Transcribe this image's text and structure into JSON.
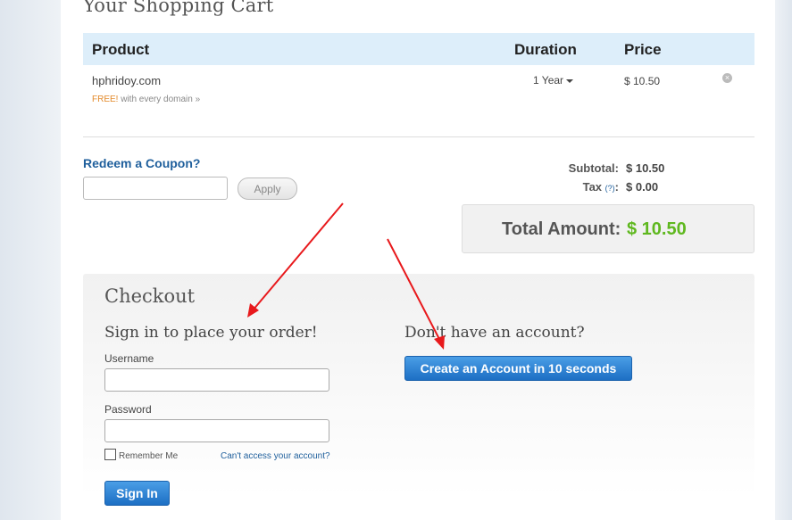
{
  "cart": {
    "title": "Your Shopping Cart",
    "columns": {
      "product": "Product",
      "duration": "Duration",
      "price": "Price"
    },
    "item": {
      "name": "hphridoy.com",
      "free_word": "FREE!",
      "free_rest": " with every domain »",
      "duration": "1 Year",
      "price": "$ 10.50"
    }
  },
  "coupon": {
    "label": "Redeem a Coupon?",
    "input_value": "",
    "apply_label": "Apply"
  },
  "totals": {
    "subtotal_label": "Subtotal:",
    "subtotal_value": "$ 10.50",
    "tax_label": "Tax",
    "tax_help": "(?)",
    "tax_colon": ":",
    "tax_value": "$ 0.00",
    "total_label": "Total Amount:",
    "total_value": "$ 10.50",
    "total_color": "#5fb81f"
  },
  "checkout": {
    "title": "Checkout",
    "signin_title": "Sign in to place your order!",
    "username_label": "Username",
    "username_value": "",
    "password_label": "Password",
    "password_value": "",
    "remember_label": "Remember Me",
    "remember_checked": false,
    "forgot_link": "Can't access your account?",
    "signin_button": "Sign In",
    "noaccount_title": "Don't have an account?",
    "create_button": "Create an Account in 10 seconds"
  },
  "icons": {
    "remove": "close-circle-icon",
    "duration_caret": "caret-down-icon",
    "annotation_arrows": "red-arrow-icon"
  },
  "colors": {
    "header_bg": "#ddeefa",
    "link": "#1f5f9c",
    "primary_button": "#2f84d6",
    "annotation": "#e8191c"
  }
}
